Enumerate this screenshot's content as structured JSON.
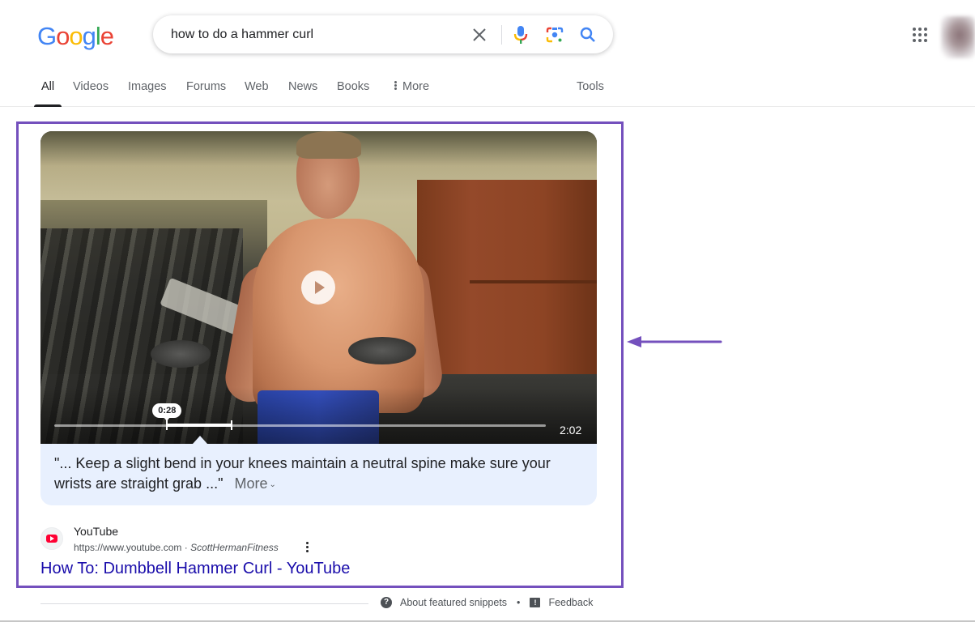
{
  "header": {
    "logo": {
      "letters": [
        "G",
        "o",
        "o",
        "g",
        "l",
        "e"
      ],
      "colors": [
        "#4285f4",
        "#ea4335",
        "#fbbc05",
        "#4285f4",
        "#34a853",
        "#ea4335"
      ]
    },
    "search": {
      "query": "how to do a hammer curl",
      "icons": {
        "clear": "close-icon",
        "voice": "microphone-icon",
        "lens": "google-lens-icon",
        "search": "search-icon"
      }
    },
    "apps_icon": "apps-grid-icon",
    "account": "avatar"
  },
  "tabs": [
    {
      "label": "All",
      "active": true
    },
    {
      "label": "Videos",
      "active": false
    },
    {
      "label": "Images",
      "active": false
    },
    {
      "label": "Forums",
      "active": false
    },
    {
      "label": "Web",
      "active": false
    },
    {
      "label": "News",
      "active": false
    },
    {
      "label": "Books",
      "active": false
    },
    {
      "label": "More",
      "active": false
    },
    {
      "label": "Tools",
      "active": false
    }
  ],
  "featured_snippet": {
    "video": {
      "current_marker": "0:28",
      "duration": "2:02",
      "segment_start_seconds": 28,
      "segment_end_seconds": 44,
      "duration_seconds": 122
    },
    "transcript": {
      "text": "\"... Keep a slight bend in your knees maintain a neutral spine make sure your wrists are straight grab ...\"",
      "more_label": "More"
    },
    "source": {
      "site_name": "YouTube",
      "url": "https://www.youtube.com",
      "separator": " · ",
      "channel": "ScottHermanFitness",
      "title": "How To: Dumbbell Hammer Curl - YouTube"
    },
    "footer": {
      "about_label": "About featured snippets",
      "dot": "•",
      "feedback_label": "Feedback"
    }
  },
  "annotation": {
    "frame_color": "#7450bd",
    "arrow_direction": "left"
  },
  "colors": {
    "link": "#1a0dab",
    "transcript_bg": "#e8f0fe",
    "text_secondary": "#5f6368"
  }
}
